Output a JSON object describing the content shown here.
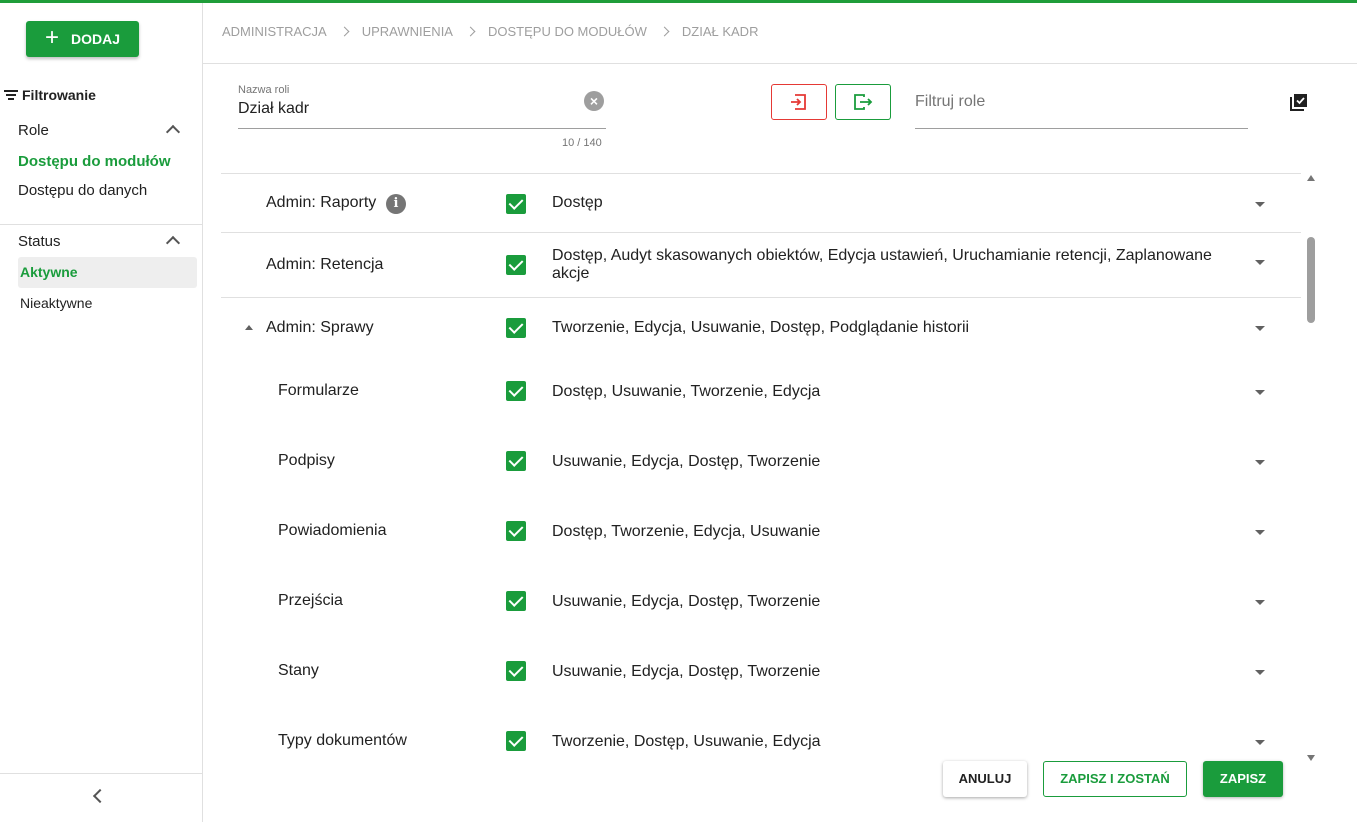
{
  "add_button": {
    "label": "DODAJ",
    "icon": "plus-icon"
  },
  "filters": {
    "title": "Filtrowanie",
    "role_group": {
      "label": "Role",
      "items": [
        "Dostępu do modułów",
        "Dostępu do danych"
      ],
      "selected": "Dostępu do modułów"
    },
    "status_group": {
      "label": "Status",
      "items": [
        "Aktywne",
        "Nieaktywne"
      ],
      "selected": "Aktywne"
    }
  },
  "breadcrumb": [
    "ADMINISTRACJA",
    "UPRAWNIENIA",
    "DOSTĘPU DO MODUŁÓW",
    "DZIAŁ KADR"
  ],
  "role_name": {
    "label": "Nazwa roli",
    "value": "Dział kadr",
    "counter": "10 / 140"
  },
  "filter_roles": {
    "placeholder": "Filtruj role"
  },
  "rows": [
    {
      "name": "Admin: Raporty",
      "info": "i",
      "checked": true,
      "permissions": "Dostęp"
    },
    {
      "name": "Admin: Retencja",
      "checked": true,
      "permissions": "Dostęp, Audyt skasowanych obiektów, Edycja ustawień, Uruchamianie retencji, Zaplanowane akcje"
    },
    {
      "name": "Admin: Sprawy",
      "expanded": true,
      "checked": true,
      "permissions": "Tworzenie, Edycja, Usuwanie, Dostęp, Podglądanie historii"
    },
    {
      "name": "Formularze",
      "checked": true,
      "permissions": "Dostęp, Usuwanie, Tworzenie, Edycja"
    },
    {
      "name": "Podpisy",
      "checked": true,
      "permissions": "Usuwanie, Edycja, Dostęp, Tworzenie"
    },
    {
      "name": "Powiadomienia",
      "checked": true,
      "permissions": "Dostęp, Tworzenie, Edycja, Usuwanie"
    },
    {
      "name": "Przejścia",
      "checked": true,
      "permissions": "Usuwanie, Edycja, Dostęp, Tworzenie"
    },
    {
      "name": "Stany",
      "checked": true,
      "permissions": "Usuwanie, Edycja, Dostęp, Tworzenie"
    },
    {
      "name": "Typy dokumentów",
      "checked": true,
      "permissions": "Tworzenie, Dostęp, Usuwanie, Edycja"
    }
  ],
  "footer": {
    "cancel": "ANULUJ",
    "save_stay": "ZAPISZ I ZOSTAŃ",
    "save": "ZAPISZ"
  },
  "colors": {
    "accent": "#1a9c3c",
    "danger": "#e53935"
  }
}
